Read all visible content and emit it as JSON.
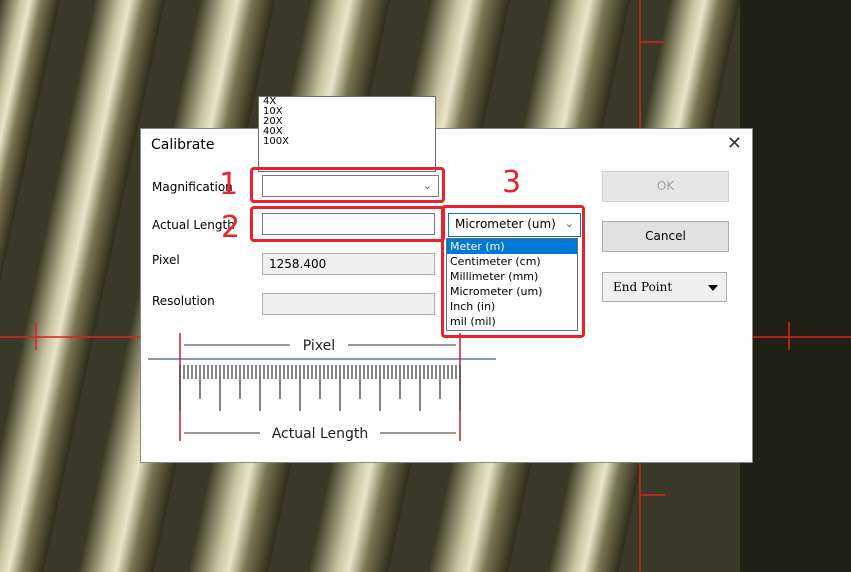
{
  "dialog": {
    "title": "Calibrate",
    "close_glyph": "✕"
  },
  "form": {
    "magnification_label": "Magnification",
    "actual_length_label": "Actual Length",
    "pixel_label": "Pixel",
    "pixel_value": "1258.400",
    "resolution_label": "Resolution",
    "magnification_value": "",
    "actual_length_value": "",
    "resolution_value": ""
  },
  "magnification_options": [
    "4X",
    "10X",
    "20X",
    "40X",
    "100X"
  ],
  "unit_select": {
    "selected": "Micrometer (um)",
    "options": [
      "Meter (m)",
      "Centimeter (cm)",
      "Millimeter (mm)",
      "Micrometer (um)",
      "Inch (in)",
      "mil (mil)"
    ],
    "highlighted_index": 0
  },
  "buttons": {
    "ok": "OK",
    "cancel": "Cancel",
    "end_point": "End Point"
  },
  "diagram": {
    "pixel_label": "Pixel",
    "actual_length_label": "Actual Length"
  },
  "annotations": [
    "1",
    "2",
    "3"
  ],
  "colors": {
    "annotation_red": "#e8232b",
    "selection_blue": "#0078d7"
  },
  "icons": {
    "combo_arrow": "chevron-down-icon",
    "end_point_arrow": "triangle-down-icon"
  }
}
